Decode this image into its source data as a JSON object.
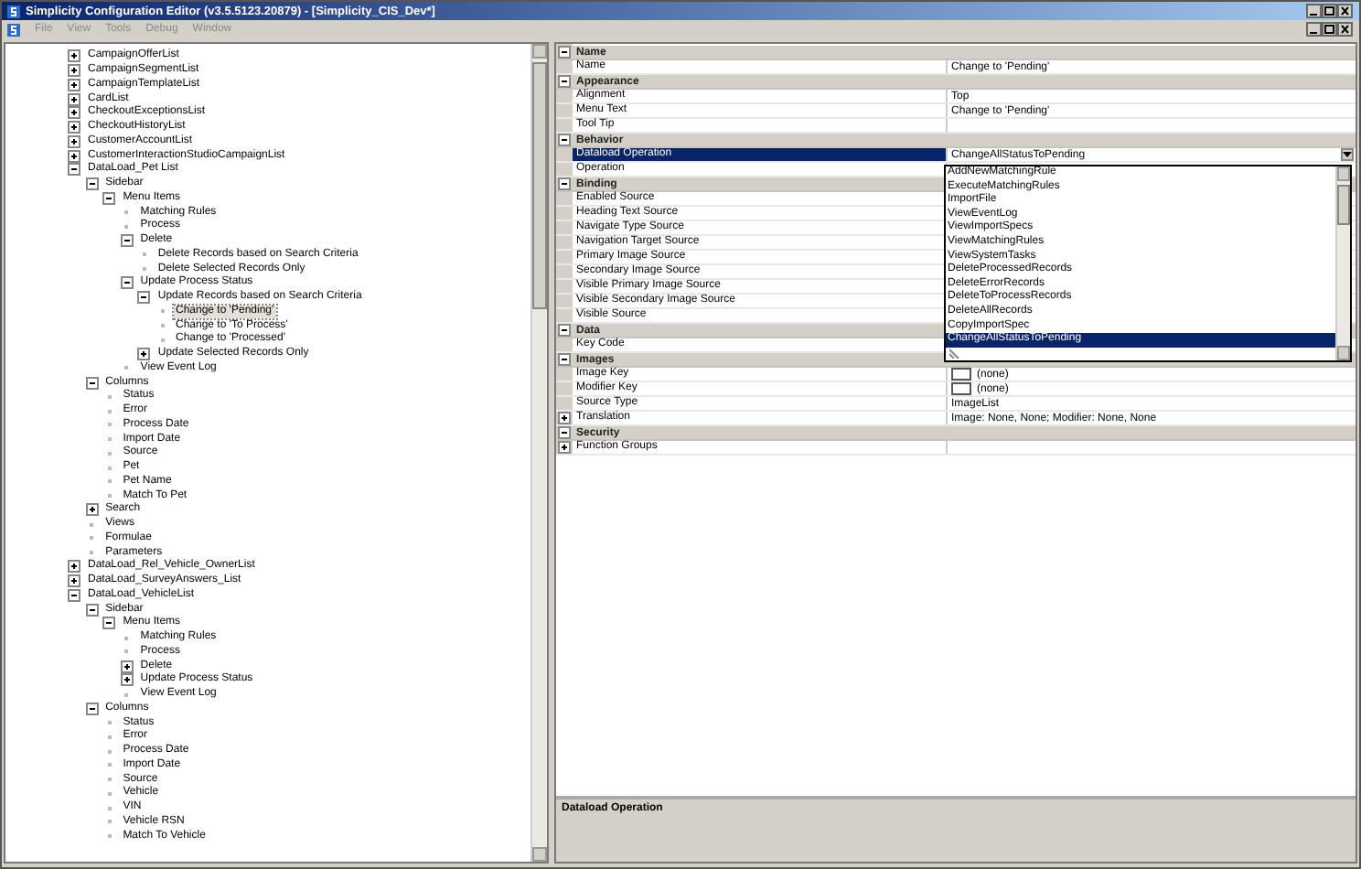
{
  "window": {
    "title": "Simplicity Configuration Editor (v3.5.5123.20879) - [Simplicity_CIS_Dev*]"
  },
  "menu": [
    {
      "label": "File",
      "disabled": true
    },
    {
      "label": "View",
      "disabled": true
    },
    {
      "label": "Tools",
      "disabled": true
    },
    {
      "label": "Debug",
      "disabled": true
    },
    {
      "label": "Window",
      "disabled": true
    }
  ],
  "tree": [
    {
      "label": "CampaignOfferList",
      "expanded": false,
      "selected": false
    },
    {
      "label": "CampaignSegmentList",
      "expanded": false,
      "selected": false
    },
    {
      "label": "CampaignTemplateList",
      "expanded": false,
      "selected": false
    },
    {
      "label": "CardList",
      "expanded": false,
      "selected": false
    },
    {
      "label": "CheckoutExceptionsList",
      "expanded": false,
      "selected": false
    },
    {
      "label": "CheckoutHistoryList",
      "expanded": false,
      "selected": false
    },
    {
      "label": "CustomerAccountList",
      "expanded": false,
      "selected": false
    },
    {
      "label": "CustomerInteractionStudioCampaignList",
      "expanded": false,
      "selected": false
    },
    {
      "label": "DataLoad_Pet List",
      "expanded": true,
      "selected": false,
      "children": [
        {
          "label": "Sidebar",
          "expanded": true,
          "selected": false,
          "children": [
            {
              "label": "Menu Items",
              "expanded": true,
              "selected": false,
              "children": [
                {
                  "label": "Matching Rules",
                  "selected": false
                },
                {
                  "label": "Process",
                  "selected": false
                },
                {
                  "label": "Delete",
                  "expanded": true,
                  "selected": false,
                  "children": [
                    {
                      "label": "Delete Records based on Search Criteria",
                      "selected": false
                    },
                    {
                      "label": "Delete Selected Records Only",
                      "selected": false
                    }
                  ]
                },
                {
                  "label": "Update Process Status",
                  "expanded": true,
                  "selected": false,
                  "children": [
                    {
                      "label": "Update Records based on Search Criteria",
                      "expanded": true,
                      "selected": false,
                      "children": [
                        {
                          "label": "Change to 'Pending'",
                          "selected": true
                        },
                        {
                          "label": "Change to 'To Process'",
                          "selected": false
                        },
                        {
                          "label": "Change to 'Processed'",
                          "selected": false
                        }
                      ]
                    },
                    {
                      "label": "Update Selected Records Only",
                      "expanded": false,
                      "selected": false
                    }
                  ]
                },
                {
                  "label": "View Event Log",
                  "selected": false
                }
              ]
            }
          ]
        },
        {
          "label": "Columns",
          "expanded": true,
          "selected": false,
          "children": [
            {
              "label": "Status",
              "selected": false
            },
            {
              "label": "Error",
              "selected": false
            },
            {
              "label": "Process Date",
              "selected": false
            },
            {
              "label": "Import Date",
              "selected": false
            },
            {
              "label": "Source",
              "selected": false
            },
            {
              "label": "Pet",
              "selected": false
            },
            {
              "label": "Pet Name",
              "selected": false
            },
            {
              "label": "Match To Pet",
              "selected": false
            }
          ]
        },
        {
          "label": "Search",
          "expanded": false,
          "selected": false
        },
        {
          "label": "Views",
          "selected": false
        },
        {
          "label": "Formulae",
          "selected": false
        },
        {
          "label": "Parameters",
          "selected": false
        }
      ]
    },
    {
      "label": "DataLoad_Rel_Vehicle_OwnerList",
      "expanded": false,
      "selected": false
    },
    {
      "label": "DataLoad_SurveyAnswers_List",
      "expanded": false,
      "selected": false
    },
    {
      "label": "DataLoad_VehicleList",
      "expanded": true,
      "selected": false,
      "children": [
        {
          "label": "Sidebar",
          "expanded": true,
          "selected": false,
          "children": [
            {
              "label": "Menu Items",
              "expanded": true,
              "selected": false,
              "children": [
                {
                  "label": "Matching Rules",
                  "selected": false
                },
                {
                  "label": "Process",
                  "selected": false
                },
                {
                  "label": "Delete",
                  "expanded": false,
                  "selected": false
                },
                {
                  "label": "Update Process Status",
                  "expanded": false,
                  "selected": false
                },
                {
                  "label": "View Event Log",
                  "selected": false
                }
              ]
            }
          ]
        },
        {
          "label": "Columns",
          "expanded": true,
          "selected": false,
          "children": [
            {
              "label": "Status",
              "selected": false
            },
            {
              "label": "Error",
              "selected": false
            },
            {
              "label": "Process Date",
              "selected": false
            },
            {
              "label": "Import Date",
              "selected": false
            },
            {
              "label": "Source",
              "selected": false
            },
            {
              "label": "Vehicle",
              "selected": false
            },
            {
              "label": "VIN",
              "selected": false
            },
            {
              "label": "Vehicle RSN",
              "selected": false
            },
            {
              "label": "Match To Vehicle",
              "selected": false
            }
          ]
        }
      ]
    }
  ],
  "properties": [
    {
      "category": "Name",
      "expanded": true,
      "items": [
        {
          "name": "Name",
          "value": "Change to 'Pending'",
          "kind": "text",
          "selected": false
        }
      ]
    },
    {
      "category": "Appearance",
      "expanded": true,
      "items": [
        {
          "name": "Alignment",
          "value": "Top",
          "kind": "text",
          "selected": false
        },
        {
          "name": "Menu Text",
          "value": "Change to 'Pending'",
          "kind": "text",
          "selected": false
        },
        {
          "name": "Tool Tip",
          "kind": "text",
          "selected": false
        }
      ]
    },
    {
      "category": "Behavior",
      "expanded": true,
      "items": [
        {
          "name": "Dataload Operation",
          "value": "ChangeAllStatusToPending",
          "kind": "dropdown",
          "selected": true
        },
        {
          "name": "Operation",
          "kind": "text",
          "selected": false
        }
      ]
    },
    {
      "category": "Binding",
      "expanded": true,
      "items": [
        {
          "name": "Enabled Source",
          "kind": "text",
          "selected": false
        },
        {
          "name": "Heading Text Source",
          "kind": "text",
          "selected": false
        },
        {
          "name": "Navigate Type Source",
          "kind": "text",
          "selected": false
        },
        {
          "name": "Navigation Target Source",
          "kind": "text",
          "selected": false
        },
        {
          "name": "Primary Image Source",
          "kind": "text",
          "selected": false
        },
        {
          "name": "Secondary Image Source",
          "kind": "text",
          "selected": false
        },
        {
          "name": "Visible Primary Image Source",
          "kind": "text",
          "selected": false
        },
        {
          "name": "Visible Secondary Image Source",
          "kind": "text",
          "selected": false
        },
        {
          "name": "Visible Source",
          "kind": "text",
          "selected": false
        }
      ]
    },
    {
      "category": "Data",
      "expanded": true,
      "items": [
        {
          "name": "Key Code",
          "kind": "text",
          "selected": false
        }
      ]
    },
    {
      "category": "Images",
      "expanded": true,
      "items": [
        {
          "name": "Image Key",
          "value": "(none)",
          "kind": "image",
          "selected": false
        },
        {
          "name": "Modifier Key",
          "value": "(none)",
          "kind": "image",
          "selected": false
        },
        {
          "name": "Source Type",
          "value": "ImageList",
          "kind": "text",
          "selected": false
        },
        {
          "name": "Translation",
          "value": "Image: None, None; Modifier: None, None",
          "kind": "text",
          "expanded": false,
          "selected": false
        }
      ]
    },
    {
      "category": "Security",
      "expanded": true,
      "items": [
        {
          "name": "Function Groups",
          "kind": "text",
          "expanded": false,
          "selected": false
        }
      ]
    }
  ],
  "dropdown": {
    "items": [
      {
        "label": "AddNewMatchingRule",
        "selected": false
      },
      {
        "label": "ExecuteMatchingRules",
        "selected": false
      },
      {
        "label": "ImportFile",
        "selected": false
      },
      {
        "label": "ViewEventLog",
        "selected": false
      },
      {
        "label": "ViewImportSpecs",
        "selected": false
      },
      {
        "label": "ViewMatchingRules",
        "selected": false
      },
      {
        "label": "ViewSystemTasks",
        "selected": false
      },
      {
        "label": "DeleteProcessedRecords",
        "selected": false
      },
      {
        "label": "DeleteErrorRecords",
        "selected": false
      },
      {
        "label": "DeleteToProcessRecords",
        "selected": false
      },
      {
        "label": "DeleteAllRecords",
        "selected": false
      },
      {
        "label": "CopyImportSpec",
        "selected": false
      },
      {
        "label": "ChangeAllStatusToPending",
        "selected": true
      }
    ]
  },
  "description": {
    "title": "Dataload Operation"
  }
}
